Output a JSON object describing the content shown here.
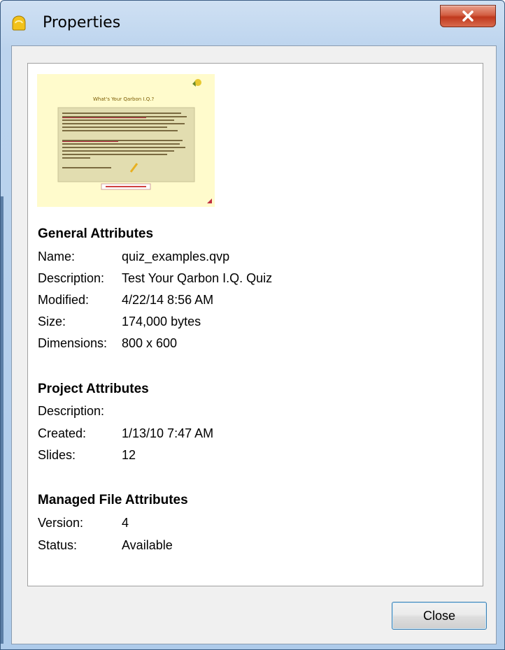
{
  "window": {
    "title": "Properties",
    "app_icon": "yellow-app-icon",
    "close_icon": "close-x-icon"
  },
  "thumbnail": {
    "heading": "What's Your Qarbon I.Q.?"
  },
  "general": {
    "title": "General Attributes",
    "rows": [
      {
        "label": "Name:",
        "value": "quiz_examples.qvp"
      },
      {
        "label": "Description:",
        "value": "Test Your Qarbon I.Q. Quiz"
      },
      {
        "label": "Modified:",
        "value": "4/22/14 8:56 AM"
      },
      {
        "label": "Size:",
        "value": "174,000 bytes"
      },
      {
        "label": "Dimensions:",
        "value": "800 x 600"
      }
    ]
  },
  "project": {
    "title": "Project Attributes",
    "rows": [
      {
        "label": "Description:",
        "value": ""
      },
      {
        "label": "Created:",
        "value": "1/13/10 7:47 AM"
      },
      {
        "label": "Slides:",
        "value": "12"
      }
    ]
  },
  "managed": {
    "title": "Managed File Attributes",
    "rows": [
      {
        "label": "Version:",
        "value": "4"
      },
      {
        "label": "Status:",
        "value": "Available"
      }
    ]
  },
  "buttons": {
    "close_label": "Close"
  },
  "colors": {
    "titlebar": "#bcd4ee",
    "close_x": "#c0391e",
    "thumbnail_bg": "#fffbcc",
    "button_border": "#3c7fb1"
  }
}
